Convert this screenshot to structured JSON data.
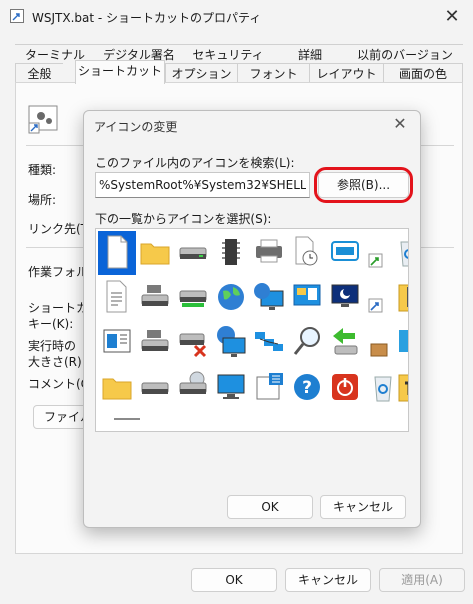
{
  "window": {
    "title": "WSJTX.bat - ショートカットのプロパティ",
    "close_glyph": "✕"
  },
  "tabs": {
    "back": [
      "ターミナル",
      "デジタル署名",
      "セキュリティ",
      "詳細",
      "以前のバージョン"
    ],
    "front": [
      "全般",
      "ショートカット",
      "オプション",
      "フォント",
      "レイアウト",
      "画面の色"
    ],
    "selected": "ショートカット"
  },
  "shortcut_panel": {
    "labels": {
      "type": "種類:",
      "location": "場所:",
      "target": "リンク先(T):",
      "start_in": "作業フォルダ",
      "hotkey_1": "ショートカット",
      "hotkey_2": "キー(K):",
      "run_1": "実行時の",
      "run_2": "大きさ(R):",
      "comment": "コメント(O):"
    },
    "open_location_button": "ファイル"
  },
  "footer": {
    "ok": "OK",
    "cancel": "キャンセル",
    "apply": "適用(A)"
  },
  "dialog": {
    "title": "アイコンの変更",
    "close_glyph": "✕",
    "search_label": "このファイル内のアイコンを検索(L):",
    "path_value": "%SystemRoot%¥System32¥SHELL32.dll",
    "browse_button": "参照(B)...",
    "list_label": "下の一覧からアイコンを選択(S):",
    "ok": "OK",
    "cancel": "キャンセル",
    "highlight_color": "#e3131b",
    "icons": [
      "blank-document-icon",
      "folder-icon",
      "drive-icon",
      "memory-chip-icon",
      "printer-icon",
      "clock-document-icon",
      "window-shortcut-icon",
      "shortcut-arrow-icon",
      "recycle-bin-icon",
      "text-document-icon",
      "network-drive-icon",
      "drive-green-icon",
      "globe-icon",
      "globe-monitor-icon",
      "control-panel-icon",
      "moon-monitor-icon",
      "shortcut-arrow-small-icon",
      "zip-document-icon",
      "window-panel-icon",
      "network-drive-2-icon",
      "drive-error-icon",
      "globe-network-icon",
      "network-computers-icon",
      "search-icon",
      "green-arrow-drive-icon",
      "box-icon",
      "blue-panel-icon",
      "folder-2-icon",
      "drive-gray-icon",
      "cd-drive-icon",
      "monitor-icon",
      "grid-document-icon",
      "help-icon",
      "power-icon",
      "recycle-bin-2-icon",
      "key-document-icon"
    ]
  }
}
